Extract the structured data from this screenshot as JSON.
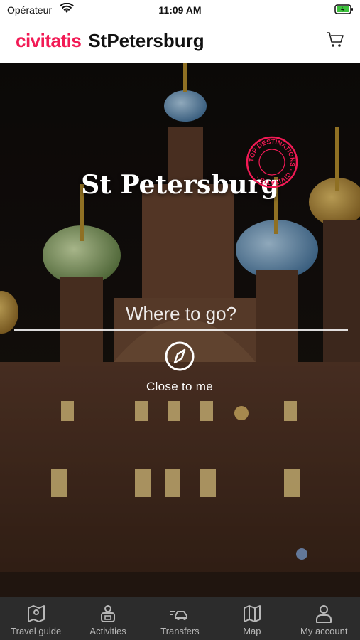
{
  "status_bar": {
    "carrier": "Opérateur",
    "time": "11:09 AM"
  },
  "header": {
    "brand": "civitatis",
    "city": "StPetersburg",
    "accent_color": "#f21a55"
  },
  "hero": {
    "title": "St Petersburg",
    "stamp_text": "TOP DESTINATIONS · CIVITATIS ·",
    "search_placeholder": "Where to go?",
    "close_label": "Close to me"
  },
  "nav": {
    "items": [
      {
        "label": "Travel guide",
        "icon": "map-book-icon"
      },
      {
        "label": "Activities",
        "icon": "activities-icon"
      },
      {
        "label": "Transfers",
        "icon": "transfer-car-icon"
      },
      {
        "label": "Map",
        "icon": "map-icon"
      },
      {
        "label": "My account",
        "icon": "user-icon"
      }
    ]
  }
}
